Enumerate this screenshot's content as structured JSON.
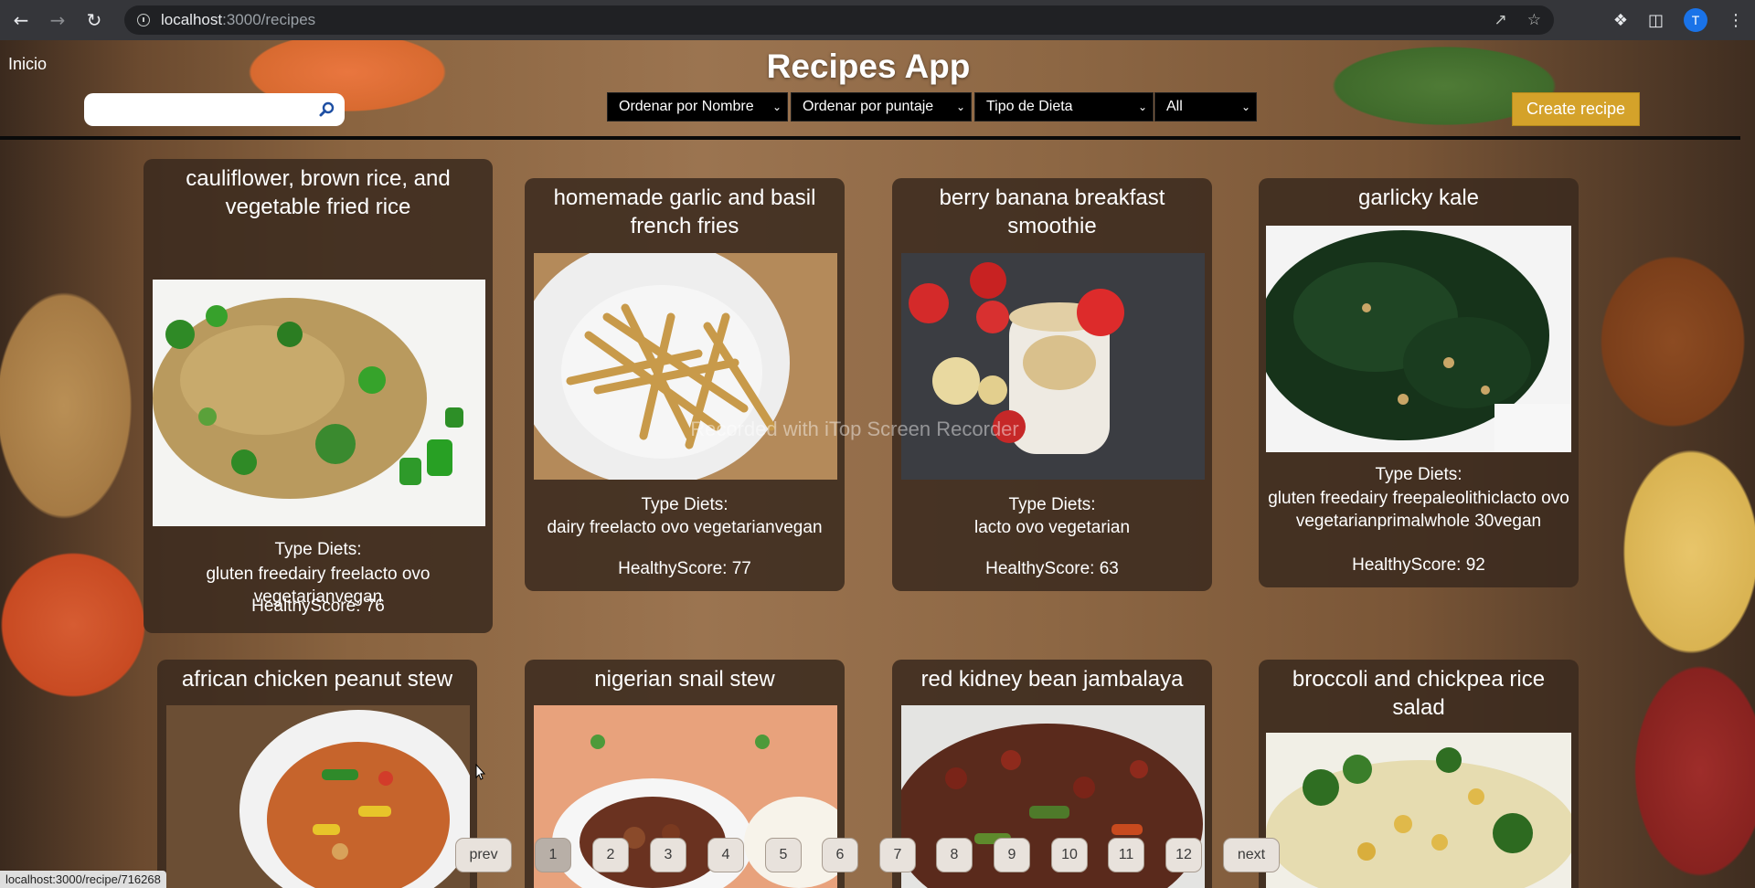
{
  "browser": {
    "url_host": "localhost",
    "url_path": ":3000/recipes",
    "avatar_letter": "T",
    "status_url": "localhost:3000/recipe/716268"
  },
  "header": {
    "title": "Recipes App",
    "home_link": "Inicio",
    "search_placeholder": "",
    "filters": [
      {
        "label": "Ordenar por Nombre"
      },
      {
        "label": "Ordenar por puntaje"
      },
      {
        "label": "Tipo de Dieta"
      },
      {
        "label": "All"
      }
    ],
    "create_label": "Create recipe"
  },
  "watermark": "Recorded with iTop Screen Recorder",
  "labels": {
    "diets": "Type Diets:",
    "score_prefix": "HealthyScore: "
  },
  "recipes": [
    {
      "title": "cauliflower, brown rice, and vegetable fried rice",
      "diets": "gluten freedairy freelacto ovo vegetarianvegan",
      "score": "HealthyScore: 76"
    },
    {
      "title": "homemade garlic and basil french fries",
      "diets": "dairy freelacto ovo vegetarianvegan",
      "score": "HealthyScore: 77"
    },
    {
      "title": "berry banana breakfast smoothie",
      "diets": "lacto ovo vegetarian",
      "score": "HealthyScore: 63"
    },
    {
      "title": "garlicky kale",
      "diets": "gluten freedairy freepaleolithiclacto ovo vegetarianprimalwhole 30vegan",
      "score": "HealthyScore: 92"
    },
    {
      "title": "african chicken peanut stew"
    },
    {
      "title": "nigerian snail stew"
    },
    {
      "title": "red kidney bean jambalaya"
    },
    {
      "title": "broccoli and chickpea rice salad"
    }
  ],
  "pagination": {
    "prev": "prev",
    "next": "next",
    "pages": [
      "1",
      "2",
      "3",
      "4",
      "5",
      "6",
      "7",
      "8",
      "9",
      "10",
      "11",
      "12"
    ],
    "current": "1"
  }
}
